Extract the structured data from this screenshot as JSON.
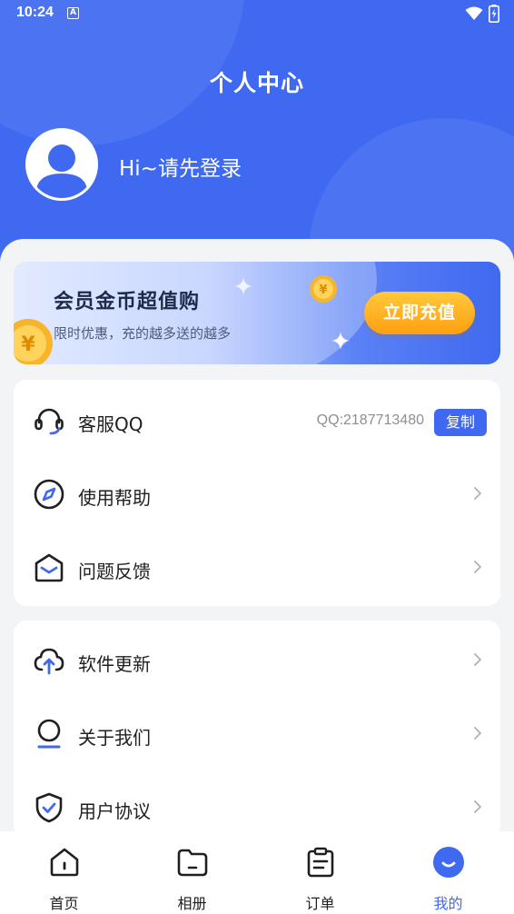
{
  "status_bar": {
    "time": "10:24",
    "notif_badge": "A"
  },
  "header": {
    "title": "个人中心",
    "login_prompt": "Hi~请先登录"
  },
  "promo": {
    "title": "会员金币超值购",
    "subtitle": "限时优惠，充的越多送的越多",
    "button_label": "立即充值",
    "coin_symbol": "¥"
  },
  "menu_group_1": [
    {
      "label": "客服QQ",
      "icon": "headset-icon",
      "qq_number": "QQ:2187713480",
      "copy_label": "复制"
    },
    {
      "label": "使用帮助",
      "icon": "compass-icon"
    },
    {
      "label": "问题反馈",
      "icon": "mail-icon"
    }
  ],
  "menu_group_2": [
    {
      "label": "软件更新",
      "icon": "cloud-upload-icon"
    },
    {
      "label": "关于我们",
      "icon": "person-icon"
    },
    {
      "label": "用户协议",
      "icon": "shield-check-icon"
    }
  ],
  "tabbar": [
    {
      "label": "首页",
      "icon": "home-icon",
      "active": false
    },
    {
      "label": "相册",
      "icon": "folder-icon",
      "active": false
    },
    {
      "label": "订单",
      "icon": "clipboard-icon",
      "active": false
    },
    {
      "label": "我的",
      "icon": "smile-icon",
      "active": true
    }
  ],
  "colors": {
    "primary": "#3f69f0",
    "background": "#f3f4f6",
    "promo_button": "#ffb020",
    "text": "#1f1f1f",
    "muted": "#8e8e93"
  }
}
